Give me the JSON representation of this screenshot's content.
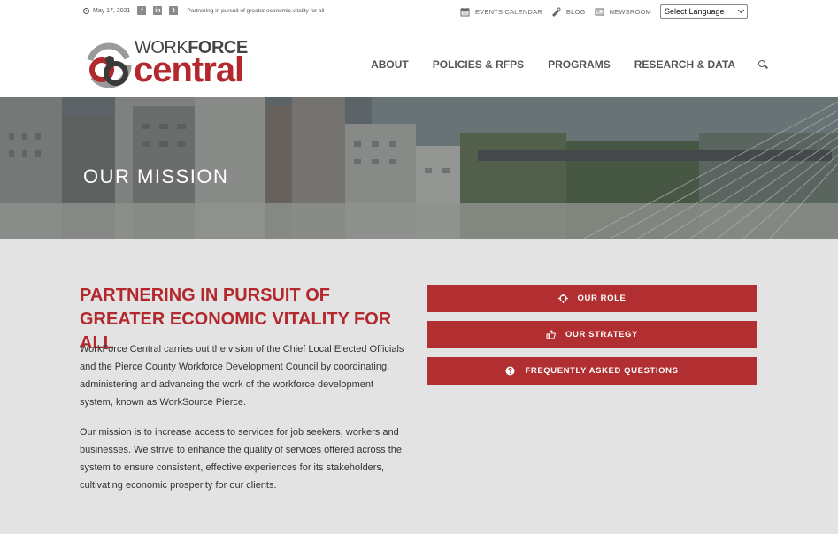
{
  "topbar": {
    "date": "May 17, 2021",
    "social": [
      {
        "icon": "facebook-icon",
        "glyph": "f"
      },
      {
        "icon": "linkedin-icon",
        "glyph": "in"
      },
      {
        "icon": "twitter-icon",
        "glyph": "t"
      }
    ],
    "tagline": "Partnering in pursuit of greater economic vitality for all",
    "links": [
      {
        "label": "EVENTS CALENDAR",
        "icon": "calendar-icon"
      },
      {
        "label": "BLOG",
        "icon": "megaphone-icon"
      },
      {
        "label": "NEWSROOM",
        "icon": "newspaper-icon"
      }
    ],
    "language_select": "Select Language"
  },
  "logo": {
    "work": "WORK",
    "force": "FORCE",
    "central": "central"
  },
  "nav": {
    "items": [
      "ABOUT",
      "POLICIES & RFPS",
      "PROGRAMS",
      "RESEARCH & DATA"
    ]
  },
  "hero": {
    "title": "OUR MISSION"
  },
  "main": {
    "heading": "PARTNERING IN PURSUIT OF GREATER ECONOMIC VITALITY FOR ALL",
    "paragraph1": "WorkForce Central carries out the vision of the Chief Local Elected Officials and the Pierce County Workforce Development Council by coordinating, administering and advancing the work of the workforce development system, known as WorkSource Pierce.",
    "paragraph2": "Our mission is to increase access to services for job seekers, workers and businesses. We strive to enhance the quality of services offered across the system to ensure consistent, effective experiences for its stakeholders, cultivating economic prosperity for our clients.",
    "buttons": [
      {
        "label": "OUR ROLE",
        "icon": "crosshair-icon"
      },
      {
        "label": "OUR STRATEGY",
        "icon": "thumbs-up-icon"
      },
      {
        "label": "FREQUENTLY ASKED QUESTIONS",
        "icon": "question-circle-icon"
      }
    ]
  },
  "colors": {
    "brand_red": "#b3282d",
    "button_red": "#b12f30",
    "main_bg": "#e3e3e3"
  }
}
